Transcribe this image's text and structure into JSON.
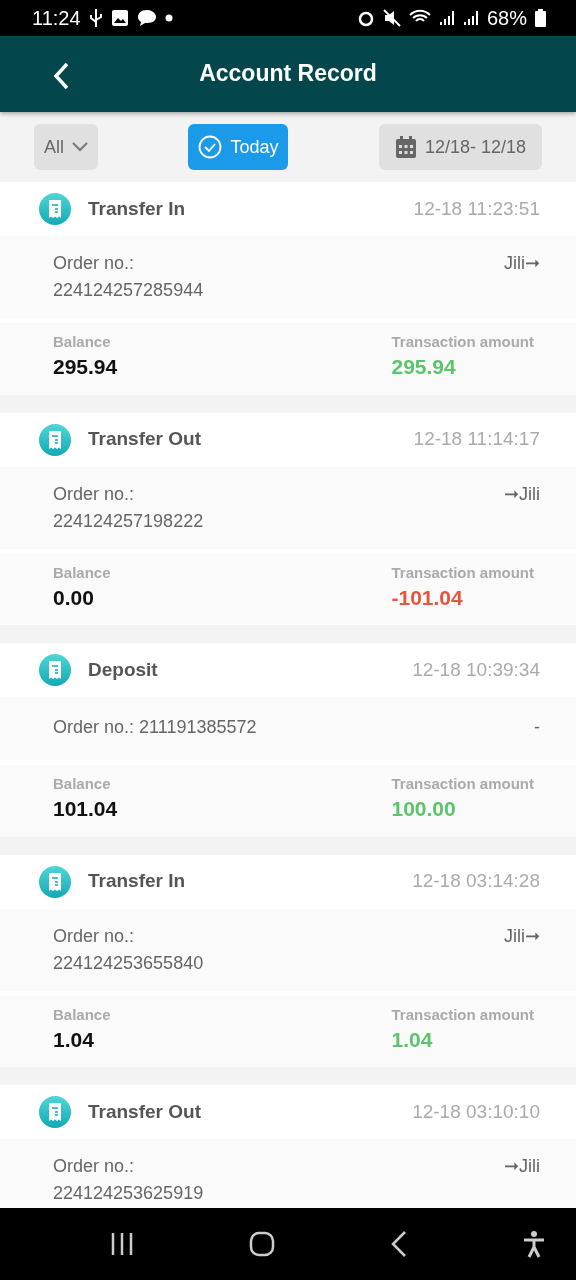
{
  "status_bar": {
    "time": "11:24",
    "battery": "68%"
  },
  "header": {
    "title": "Account Record"
  },
  "filters": {
    "type": {
      "label": "All"
    },
    "today": {
      "label": "Today",
      "selected": true
    },
    "date_range": {
      "label": "12/18- 12/18"
    }
  },
  "records": [
    {
      "type": "Transfer In",
      "time": "12-18 11:23:51",
      "order_label": "Order no.:",
      "order_no": "224124257285944",
      "kind": "stacked",
      "route": "Jili➞",
      "balance_label": "Balance",
      "balance": "295.94",
      "amount_label": "Transaction amount",
      "amount": "295.94",
      "color": "#5cc46a"
    },
    {
      "type": "Transfer Out",
      "time": "12-18 11:14:17",
      "order_label": "Order no.:",
      "order_no": "224124257198222",
      "kind": "stacked",
      "route": "➞Jili",
      "balance_label": "Balance",
      "balance": "0.00",
      "amount_label": "Transaction amount",
      "amount": "-101.04",
      "color": "#e8553e"
    },
    {
      "type": "Deposit",
      "time": "12-18 10:39:34",
      "order_label": "Order no.:",
      "order_no": "211191385572",
      "kind": "inline",
      "route": "-",
      "balance_label": "Balance",
      "balance": "101.04",
      "amount_label": "Transaction amount",
      "amount": "100.00",
      "color": "#5cc46a"
    },
    {
      "type": "Transfer In",
      "time": "12-18 03:14:28",
      "order_label": "Order no.:",
      "order_no": "224124253655840",
      "kind": "stacked",
      "route": "Jili➞",
      "balance_label": "Balance",
      "balance": "1.04",
      "amount_label": "Transaction amount",
      "amount": "1.04",
      "color": "#5cc46a"
    },
    {
      "type": "Transfer Out",
      "time": "12-18 03:10:10",
      "order_label": "Order no.:",
      "order_no": "224124253625919",
      "kind": "stacked",
      "route": "➞Jili"
    }
  ]
}
